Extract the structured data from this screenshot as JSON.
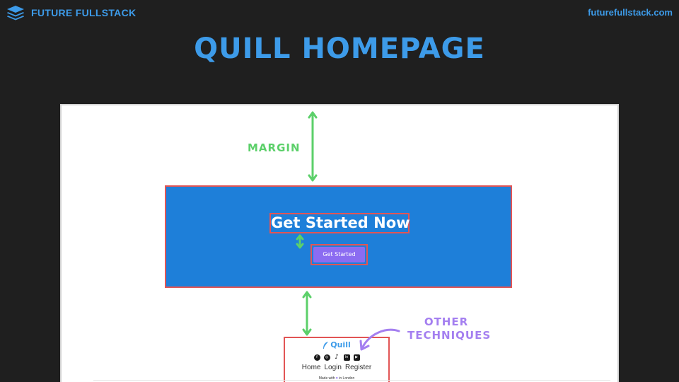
{
  "brand": {
    "name": "FUTURE FULLSTACK",
    "url": "futurefullstack.com",
    "logo_icon": "layers-icon",
    "color": "#3d9be9"
  },
  "slide": {
    "title": "QUILL HOMEPAGE"
  },
  "mockup": {
    "hero": {
      "heading": "Get Started Now",
      "button_label": "Get Started",
      "background": "#1e7fd9",
      "button_color": "#8b6cf1"
    },
    "footer": {
      "logo_text": "Quill",
      "logo_icon": "feather-icon",
      "social_icons": [
        "facebook-icon",
        "instagram-icon",
        "tiktok-icon",
        "linkedin-icon",
        "youtube-icon"
      ],
      "nav": [
        "Home",
        "Login",
        "Register"
      ],
      "made_with_prefix": "Made with",
      "made_with_suffix": "in London"
    },
    "highlight_color": "#e25555"
  },
  "annotations": {
    "margin_label": "MARGIN",
    "other_label_line1": "OTHER",
    "other_label_line2": "TECHNIQUES",
    "margin_color": "#5cd06a",
    "other_color": "#a47ff0"
  }
}
